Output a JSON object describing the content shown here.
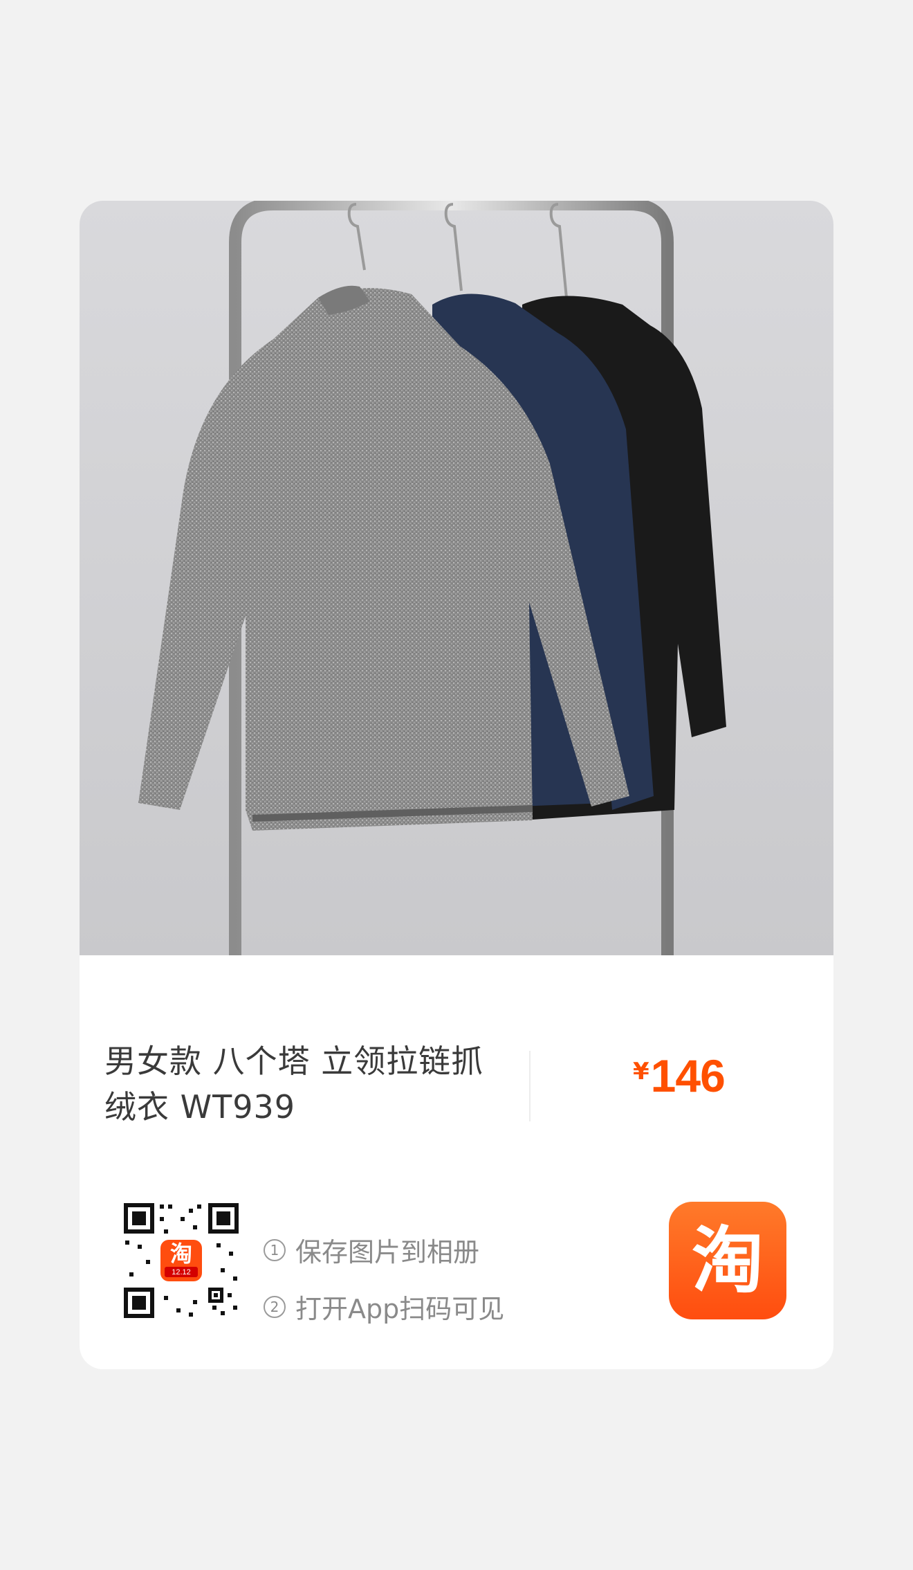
{
  "product": {
    "title_line1": "男女款 八个塔 立领拉链抓",
    "title_line2": "绒衣 WT939",
    "currency_symbol": "¥",
    "price": "146"
  },
  "share": {
    "step1_number": "①",
    "step1_text": "保存图片到相册",
    "step2_number": "②",
    "step2_text": "打开App扫码可见",
    "qr_badge_text": "淘",
    "qr_badge_sub": "12.12"
  },
  "brand": {
    "logo_glyph": "淘",
    "color": "#ff5000"
  },
  "icons": {
    "qr": "qr-code-icon",
    "logo": "taobao-logo-icon"
  }
}
